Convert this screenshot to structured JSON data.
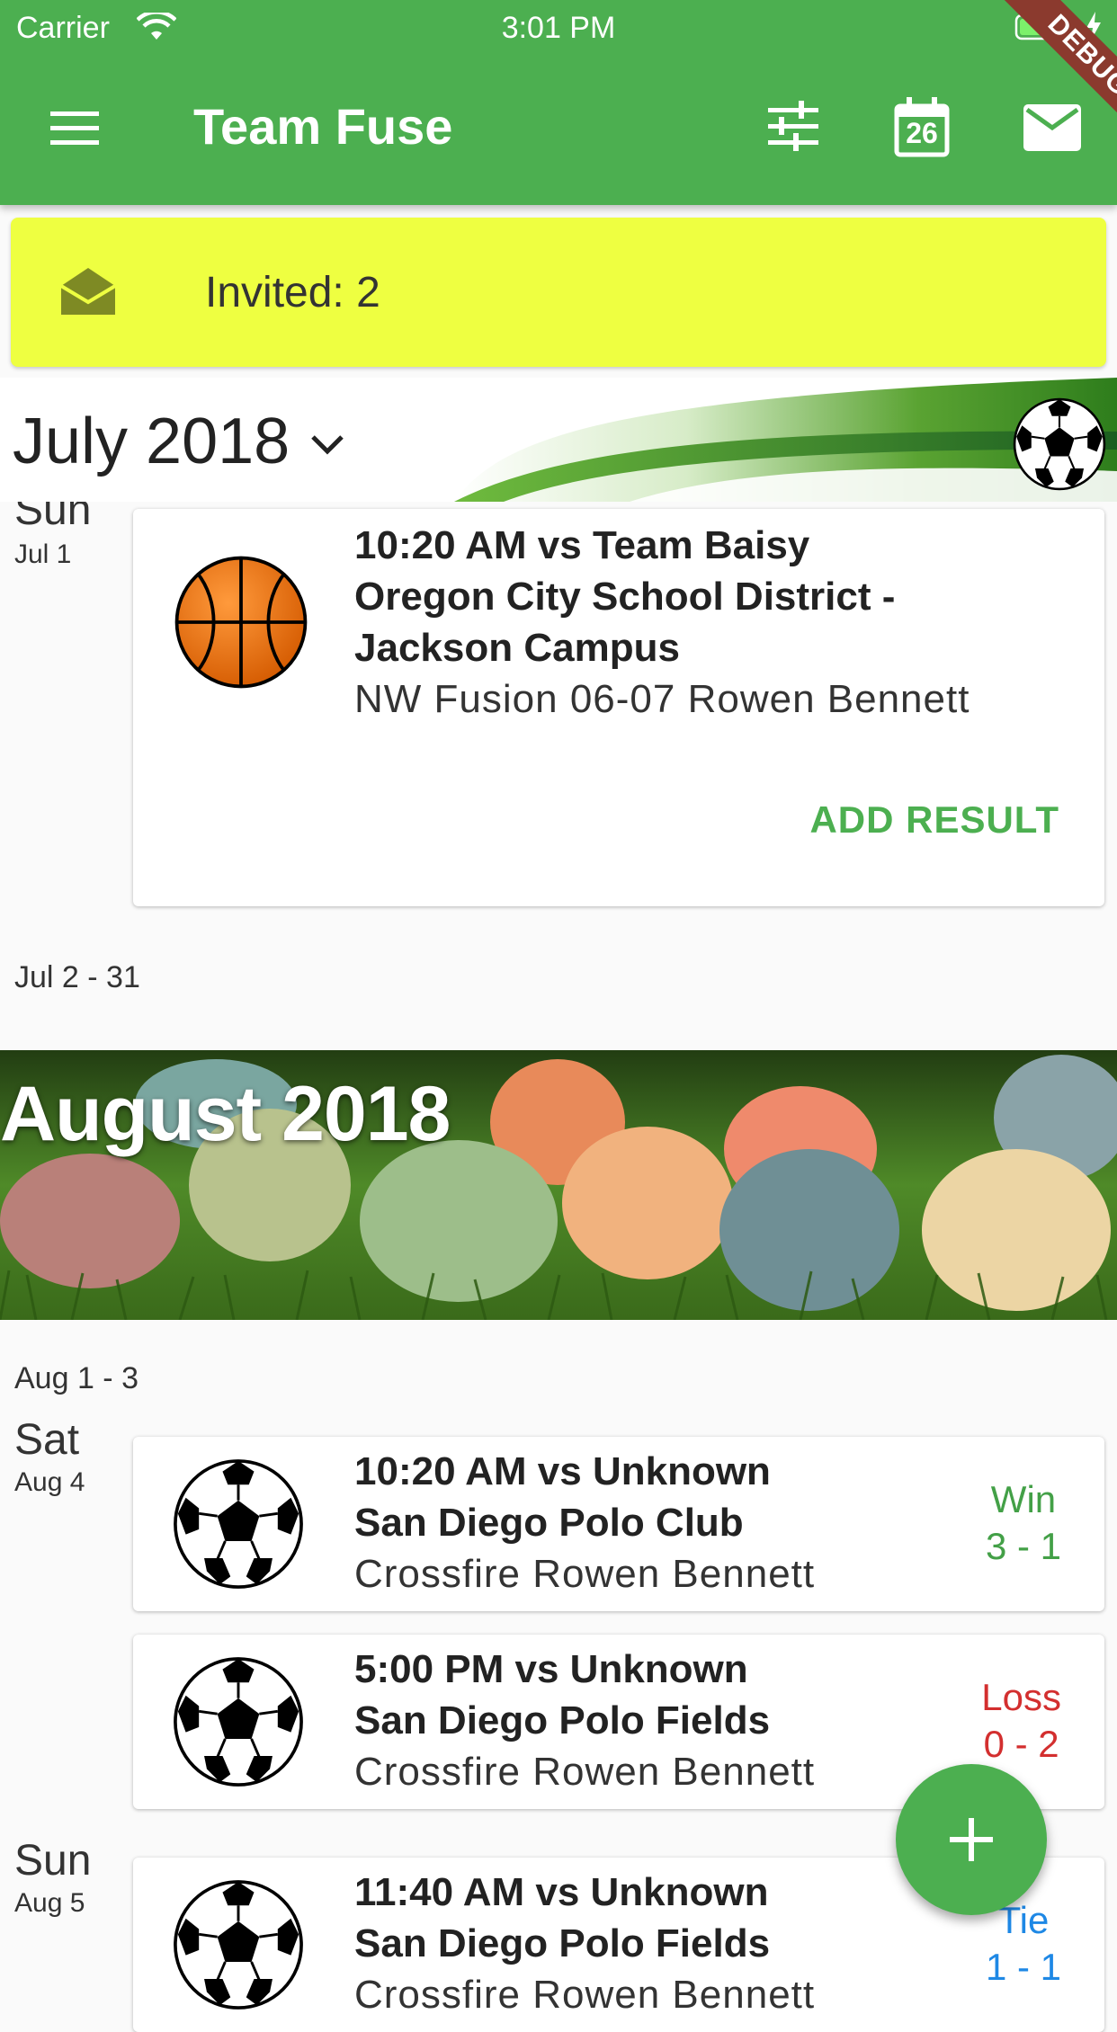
{
  "status_bar": {
    "carrier": "Carrier",
    "time": "3:01 PM",
    "debug_label": "DEBUG"
  },
  "app_bar": {
    "title": "Team Fuse",
    "calendar_day": "26",
    "icons": [
      "menu-icon",
      "tune-icon",
      "calendar-icon",
      "mail-icon"
    ]
  },
  "invite_banner": {
    "text": "Invited: 2",
    "icon": "open-envelope-icon"
  },
  "july": {
    "month_label": "July 2018",
    "day": {
      "weekday": "Sun",
      "date": "Jul 1",
      "game": {
        "sport_icon": "basketball-icon",
        "line1": "10:20 AM vs Team Baisy",
        "line2": "Oregon City School District -",
        "line3": "Jackson Campus",
        "line4": "NW Fusion 06-07 Rowen Bennett",
        "action": "ADD RESULT"
      }
    },
    "range": "Jul 2 - 31"
  },
  "august": {
    "month_label": "August 2018",
    "range": "Aug 1 - 3",
    "days": [
      {
        "weekday": "Sat",
        "date": "Aug 4",
        "games": [
          {
            "sport_icon": "soccer-ball-icon",
            "line1": "10:20 AM vs Unknown",
            "line2": "San Diego Polo Club",
            "line3": "Crossfire Rowen Bennett",
            "result_label": "Win",
            "result_score": "3 - 1"
          },
          {
            "sport_icon": "soccer-ball-icon",
            "line1": "5:00 PM vs Unknown",
            "line2": "San Diego Polo Fields",
            "line3": "Crossfire Rowen Bennett",
            "result_label": "Loss",
            "result_score": "0 - 2"
          }
        ]
      },
      {
        "weekday": "Sun",
        "date": "Aug 5",
        "games": [
          {
            "sport_icon": "soccer-ball-icon",
            "line1": "11:40 AM vs Unknown",
            "line2": "San Diego Polo Fields",
            "line3": "Crossfire Rowen Bennett",
            "result_label": "Tie",
            "result_score": "1 - 1"
          }
        ]
      }
    ]
  },
  "colors": {
    "primary": "#4caf50",
    "invite_bg": "#eeff41",
    "win": "#43a047",
    "loss": "#d32f2f",
    "tie": "#1e88e5",
    "debug_ribbon": "#8b3a2e"
  },
  "fab": {
    "icon": "plus-icon"
  }
}
